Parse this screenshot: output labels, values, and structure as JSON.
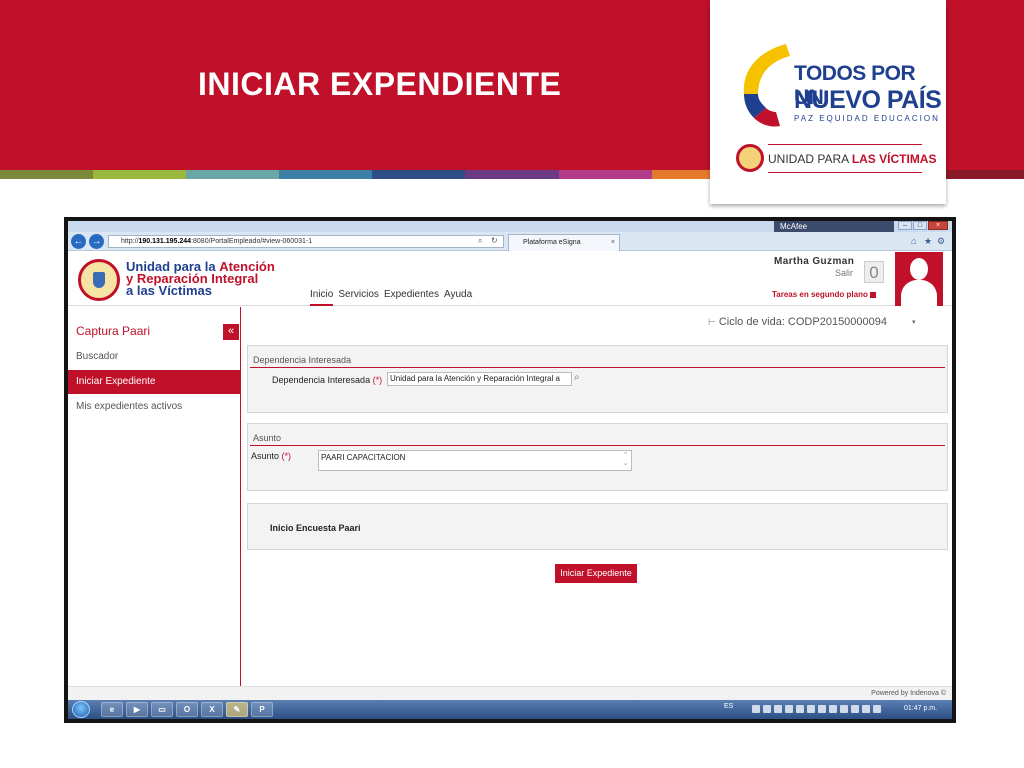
{
  "slide": {
    "title": "INICIAR EXPENDIENTE",
    "stripe_colors": [
      "#7a8a3a",
      "#9ab73e",
      "#6aa6a5",
      "#3b7fa7",
      "#2e4f86",
      "#6b3a82",
      "#b23c8a",
      "#e57a2b",
      "#f2b33a",
      "#c0102a",
      "#8a1a2a"
    ],
    "logo": {
      "line1": "TODOS POR UN",
      "line2": "NUEVO PAÍS",
      "line3": "PAZ  EQUIDAD  EDUCACION",
      "unidad": "UNIDAD PARA",
      "victimas": "LAS VÍCTIMAS"
    }
  },
  "browser": {
    "mcafee": "McAfee",
    "address_prefix": "http://",
    "address_host": "190.131.195.244",
    "address_rest": ":8080/PortalEmpleado/#view-060031-1",
    "tab_title": "Plataforma eSigna",
    "tab_close": "×"
  },
  "app": {
    "org_line1": "Unidad para la ",
    "org_line1_accent": "Atención",
    "org_line2": "y Reparación Integral",
    "org_line3": "a las Víctimas",
    "menu": [
      "Inicio",
      "Servicios",
      "Expedientes",
      "Ayuda"
    ],
    "user_name": "Martha Guzman",
    "salir": "Salir",
    "notifications": "0",
    "tareas": "Tareas en segundo plano"
  },
  "sidebar": {
    "title": "Captura Paari",
    "collapse": "«",
    "items": [
      {
        "label": "Buscador"
      },
      {
        "label": "Iniciar Expediente"
      },
      {
        "label": "Mis expedientes activos"
      }
    ]
  },
  "main": {
    "lifecycle": "Ciclo de vida: CODP20150000094",
    "dependencia": {
      "header": "Dependencia Interesada",
      "label": "Dependencia Interesada",
      "required": "(*)",
      "value": "Unidad para la Atención y Reparación Integral a"
    },
    "asunto": {
      "header": "Asunto",
      "label": "Asunto",
      "required": "(*)",
      "value": "PAARI CAPACITACION"
    },
    "encuesta": "Inicio Encuesta Paari",
    "submit": "Iniciar Expediente",
    "powered": "Powered by Indenova ©"
  },
  "taskbar": {
    "lang": "ES",
    "clock": "01:47 p.m."
  }
}
